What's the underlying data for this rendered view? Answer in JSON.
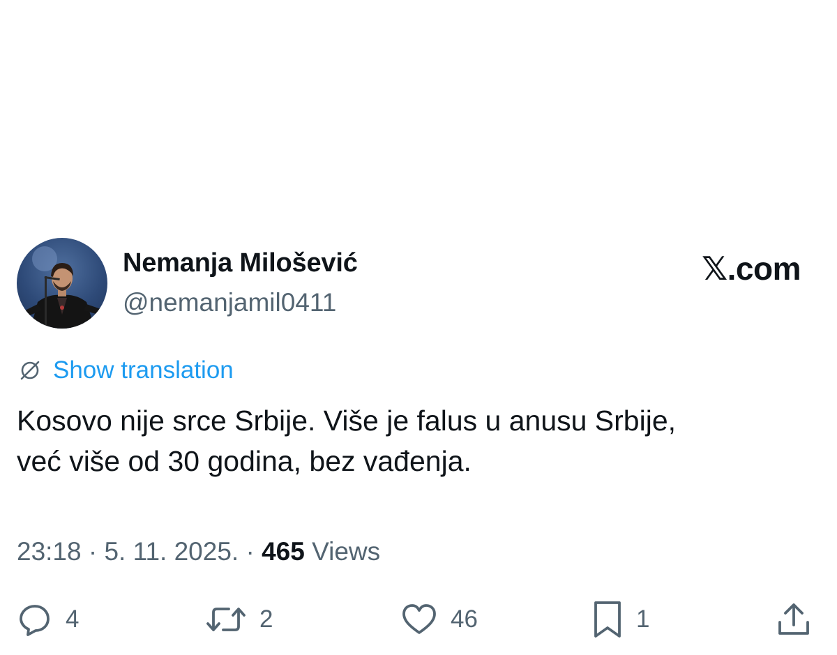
{
  "author": {
    "display_name": "Nemanja Milošević",
    "handle": "@nemanjamil0411"
  },
  "brand": {
    "label": "𝕏.com"
  },
  "translation": {
    "label": "Show translation",
    "icon": "globe-slash-icon"
  },
  "tweet": {
    "lines": [
      "Kosovo nije srce Srbije. Više je falus u anusu Srbije,",
      "već više od 30 godina, bez vađenja."
    ],
    "time": "23:18",
    "date": "5. 11. 2025.",
    "views_count": "465",
    "views_label": "Views",
    "separator": "·"
  },
  "actions": {
    "reply": {
      "icon": "reply-icon",
      "count": "4"
    },
    "retweet": {
      "icon": "retweet-icon",
      "count": "2"
    },
    "like": {
      "icon": "heart-icon",
      "count": "46"
    },
    "bookmark": {
      "icon": "bookmark-icon",
      "count": "1"
    },
    "share": {
      "icon": "share-icon"
    }
  },
  "colors": {
    "text_primary": "#0f1419",
    "text_secondary": "#536471",
    "link_blue": "#1d9bf0",
    "background": "#ffffff"
  }
}
